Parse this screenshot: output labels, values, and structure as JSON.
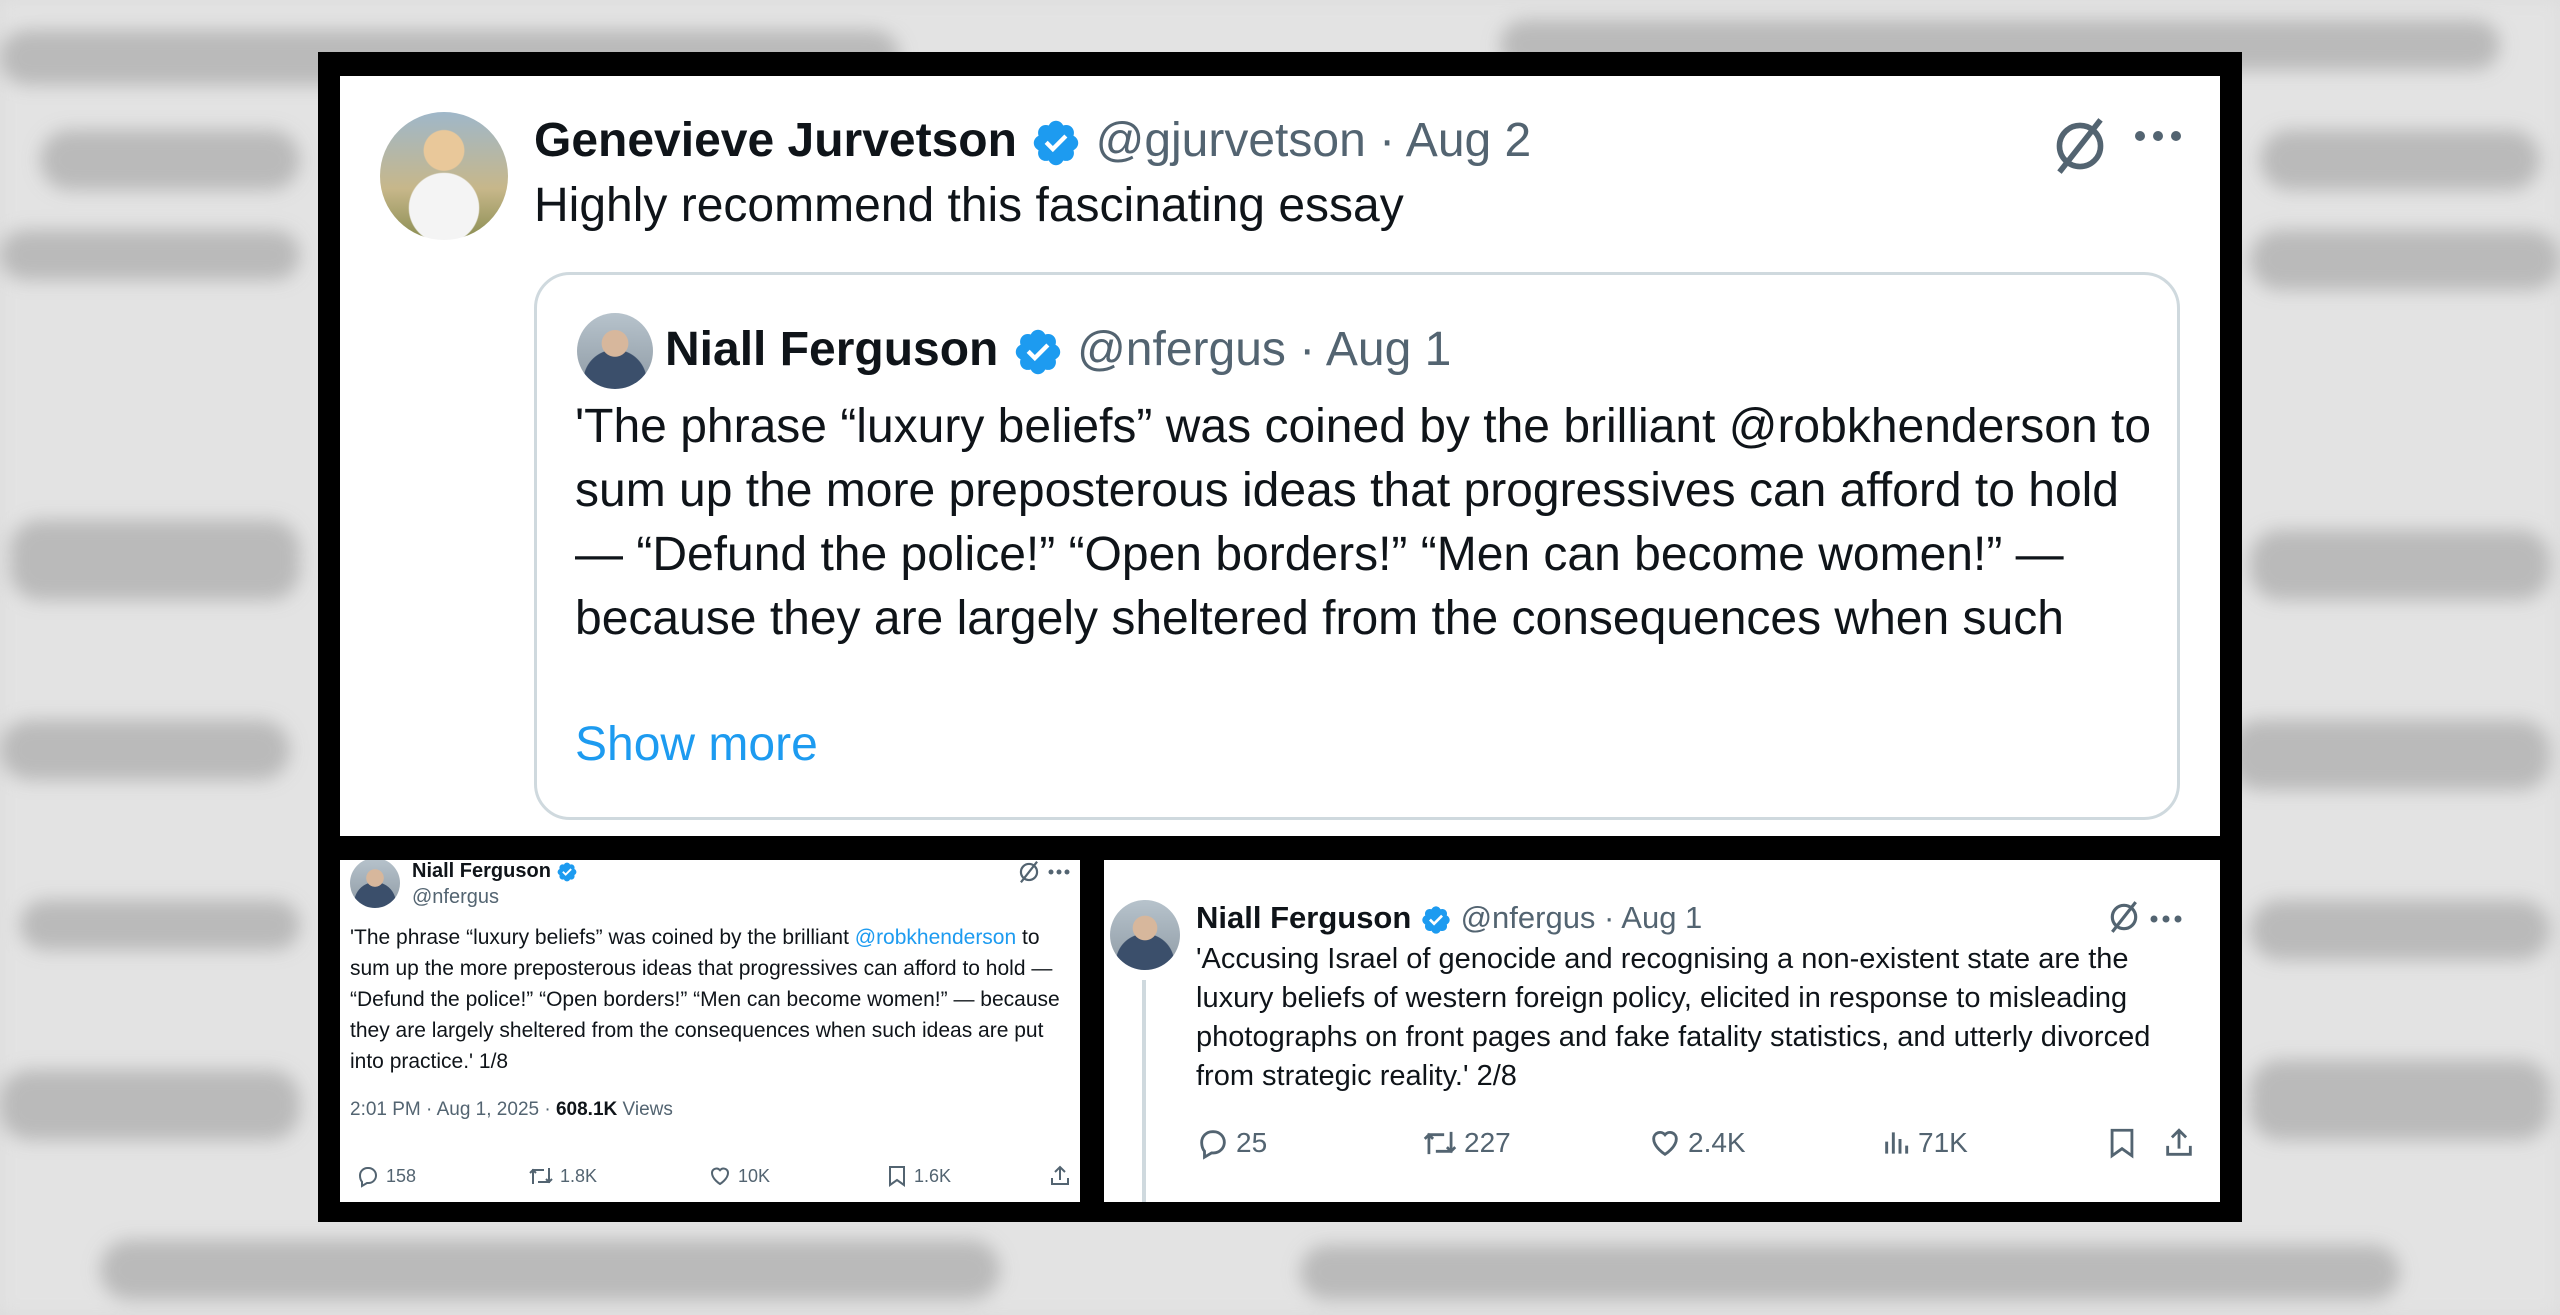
{
  "top_post": {
    "author_name": "Genevieve Jurvetson",
    "handle": "@gjurvetson",
    "date": "Aug 2",
    "text": "Highly recommend this fascinating essay",
    "quoted": {
      "author_name": "Niall Ferguson",
      "handle": "@nfergus",
      "date": "Aug 1",
      "text": "'The phrase “luxury beliefs” was coined by the brilliant @robkhenderson to sum up the more preposterous ideas that progressives can afford to hold — “Defund the police!” “Open borders!” “Men can become women!” — because they are largely sheltered from the consequences when such",
      "show_more": "Show more"
    }
  },
  "left_post": {
    "author_name": "Niall Ferguson",
    "handle": "@nfergus",
    "text_before": "'The phrase “luxury beliefs” was coined by the brilliant ",
    "mention": "@robkhenderson",
    "text_after": " to sum up the more preposterous ideas that progressives can afford to hold — “Defund the police!” “Open borders!” “Men can become women!” — because they are largely sheltered from the consequences when such ideas are put into practice.' 1/8",
    "timestamp": "2:01 PM · Aug 1, 2025 · ",
    "views_count": "608.1K",
    "views_label": " Views",
    "stats": {
      "replies": "158",
      "reposts": "1.8K",
      "likes": "10K",
      "bookmarks": "1.6K"
    }
  },
  "right_post": {
    "author_name": "Niall Ferguson",
    "handle": "@nfergus",
    "date": "Aug 1",
    "text": "'Accusing Israel of genocide and recognising a non-existent state are the luxury beliefs of western foreign policy, elicited in response to misleading photographs on front pages and fake fatality statistics, and utterly divorced from strategic reality.' 2/8",
    "stats": {
      "replies": "25",
      "reposts": "227",
      "likes": "2.4K",
      "views": "71K"
    }
  },
  "separator": " · ",
  "colors": {
    "verified": "#1d9bf0",
    "text": "#0f1419",
    "muted": "#536471",
    "link": "#1d9bf0"
  }
}
